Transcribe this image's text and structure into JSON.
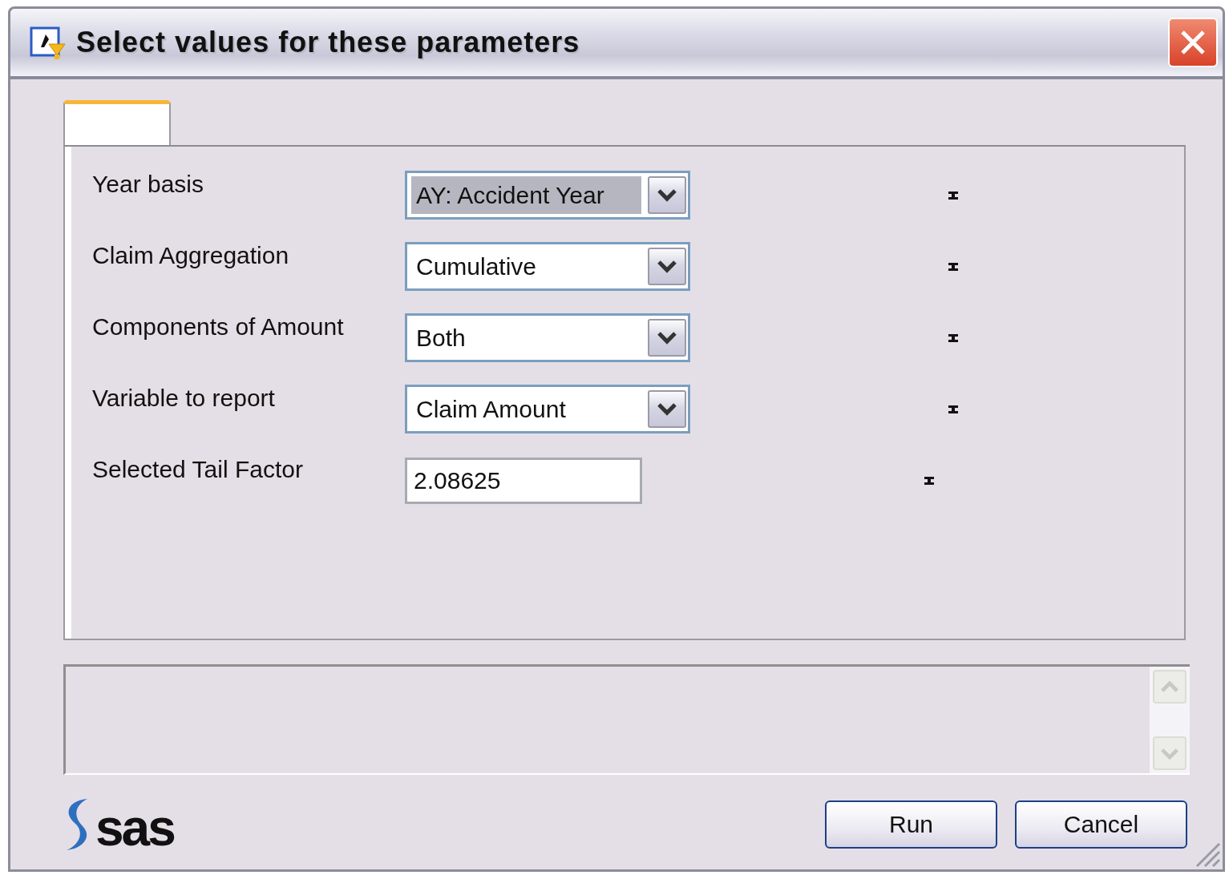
{
  "window": {
    "title": "Select values for these parameters"
  },
  "parameters": [
    {
      "label": "Year basis",
      "kind": "combo",
      "value": "AY: Accident Year",
      "focused": true,
      "required": true
    },
    {
      "label": "Claim Aggregation",
      "kind": "combo",
      "value": "Cumulative",
      "focused": false,
      "required": true
    },
    {
      "label": "Components of Amount",
      "kind": "combo",
      "value": "Both",
      "focused": false,
      "required": true
    },
    {
      "label": "Variable to report",
      "kind": "combo",
      "value": "Claim Amount",
      "focused": false,
      "required": true
    },
    {
      "label": "Selected Tail Factor",
      "kind": "text",
      "value": "2.08625",
      "focused": false,
      "required": true
    }
  ],
  "logo": {
    "text": "sas"
  },
  "buttons": [
    "Run",
    "Cancel"
  ]
}
